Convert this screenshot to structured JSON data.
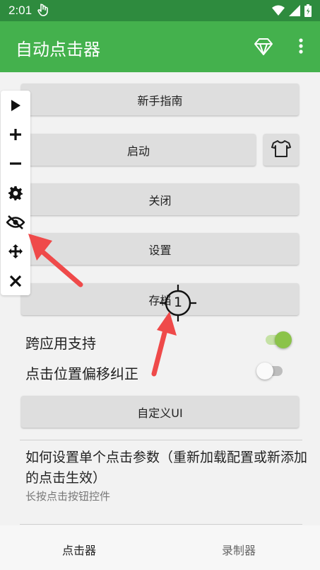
{
  "status_bar": {
    "time": "2:01"
  },
  "app_bar": {
    "title": "自动点击器"
  },
  "buttons": {
    "guide": "新手指南",
    "start": "启动",
    "stop": "关闭",
    "settings": "设置",
    "save": "存档",
    "custom_ui": "自定义UI"
  },
  "toggles": {
    "cross_app": {
      "label": "跨应用支持",
      "on": true
    },
    "offset_fix": {
      "label": "点击位置偏移纠正",
      "on": false
    }
  },
  "info": {
    "title": "如何设置单个点击参数（重新加载配置或新添加的点击生效）",
    "subtitle": "长按点击按钮控件"
  },
  "target": {
    "number": "1"
  },
  "bottom_nav": {
    "clicker": "点击器",
    "recorder": "录制器"
  },
  "colors": {
    "status_bar": "#2e8b3e",
    "app_bar": "#44b14d",
    "accent": "#8bc34a",
    "arrow": "#ef4a4a"
  },
  "icons": [
    "hand-icon",
    "wifi-icon",
    "signal-icon",
    "battery-icon",
    "gem-icon",
    "more-vert-icon",
    "shirt-icon",
    "play-icon",
    "plus-icon",
    "minus-icon",
    "settings-gear-icon",
    "eye-off-icon",
    "move-icon",
    "close-icon"
  ]
}
